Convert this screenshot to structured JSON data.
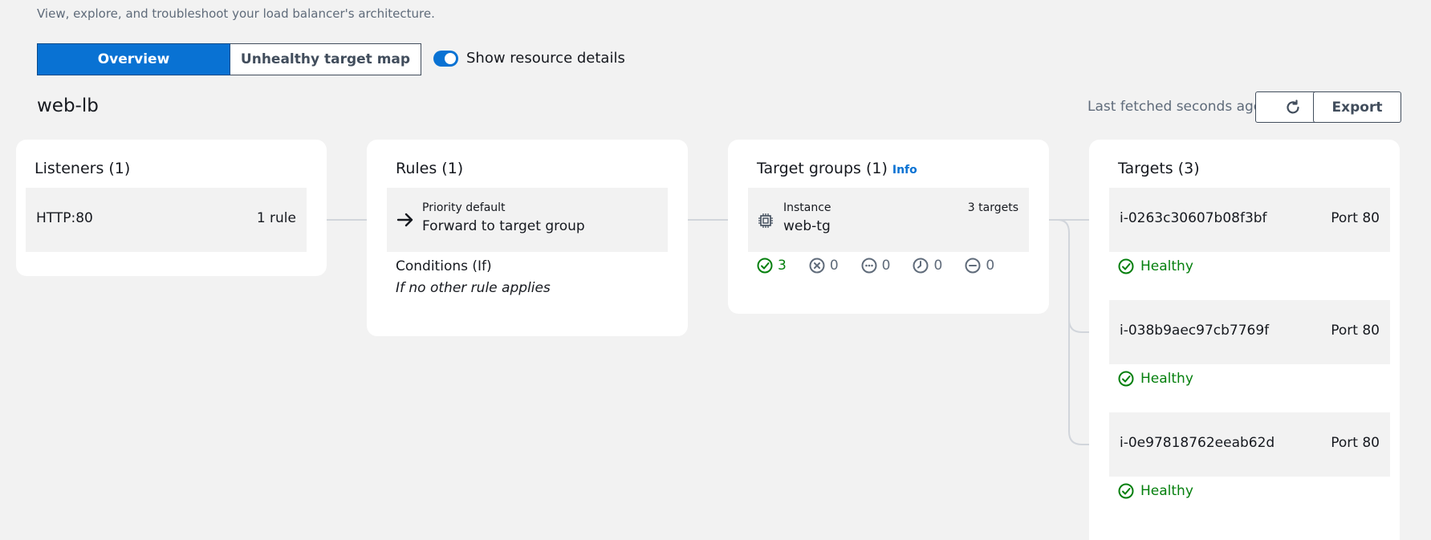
{
  "page": {
    "subtitle": "View, explore, and troubleshoot your load balancer's architecture.",
    "tabs": [
      {
        "label": "Overview",
        "selected": true
      },
      {
        "label": "Unhealthy target map",
        "selected": false
      }
    ],
    "toggle": {
      "label": "Show resource details",
      "on": true
    },
    "lb_name": "web-lb",
    "last_fetched": "Last fetched seconds ago",
    "refresh_icon": "refresh-icon",
    "export_label": "Export"
  },
  "listeners": {
    "title": "Listeners (1)",
    "items": [
      {
        "name": "HTTP:80",
        "rules": "1 rule"
      }
    ]
  },
  "rules": {
    "title": "Rules (1)",
    "items": [
      {
        "priority": "Priority default",
        "action": "Forward to target group",
        "icon": "arrow-right-icon"
      }
    ],
    "conditions_label": "Conditions (If)",
    "conditions_value": "If no other rule applies"
  },
  "target_groups": {
    "title": "Target groups (1)",
    "info_label": "Info",
    "items": [
      {
        "type": "Instance",
        "name": "web-tg",
        "count": "3 targets",
        "icon": "chip-icon"
      }
    ],
    "status_counts": [
      {
        "icon": "healthy-icon",
        "value": "3"
      },
      {
        "icon": "unhealthy-icon",
        "value": "0"
      },
      {
        "icon": "unused-icon",
        "value": "0"
      },
      {
        "icon": "pending-icon",
        "value": "0"
      },
      {
        "icon": "draining-icon",
        "value": "0"
      }
    ]
  },
  "targets": {
    "title": "Targets (3)",
    "items": [
      {
        "id": "i-0263c30607b08f3bf",
        "port": "Port 80",
        "status": "Healthy"
      },
      {
        "id": "i-038b9aec97cb7769f",
        "port": "Port 80",
        "status": "Healthy"
      },
      {
        "id": "i-0e97818762eeab62d",
        "port": "Port 80",
        "status": "Healthy"
      }
    ]
  },
  "colors": {
    "accent": "#0972d3",
    "healthy": "#037f0c",
    "background": "#f2f2f2",
    "card": "#ffffff"
  }
}
